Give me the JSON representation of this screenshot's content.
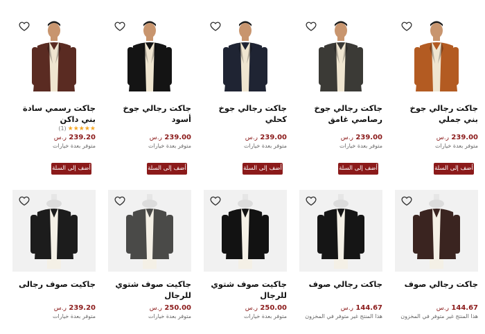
{
  "currency_symbol": "ر.س",
  "add_to_cart_label": "أضف إلى السلة",
  "row1": [
    {
      "title": "جاكت رجالي جوخ بني جملي",
      "price": "239.00",
      "stock": "متوفر بعدة خيارات",
      "jacket_color": "#b35b22",
      "rating": null
    },
    {
      "title": "جاكت رجالي جوخ رصاصي غامق",
      "price": "239.00",
      "stock": "متوفر بعدة خيارات",
      "jacket_color": "#3b3a36",
      "rating": null
    },
    {
      "title": "جاكت رجالي جوخ كحلي",
      "price": "239.00",
      "stock": "متوفر بعدة خيارات",
      "jacket_color": "#1f2433",
      "rating": null
    },
    {
      "title": "جاكت رجالي جوخ أسود",
      "price": "239.00",
      "stock": "متوفر بعدة خيارات",
      "jacket_color": "#141414",
      "rating": null
    },
    {
      "title": "جاكت رسمي سادة بني داكن",
      "price": "239.20",
      "stock": "متوفر بعدة خيارات",
      "jacket_color": "#5a2b22",
      "rating": {
        "stars": "★★★★★",
        "count": "(1)"
      }
    }
  ],
  "row2": [
    {
      "title": "جاكت رجالي صوف",
      "price": "144.67",
      "stock": "هذا المنتج غير متوفر في المخزون",
      "jacket_color": "#3a2420"
    },
    {
      "title": "جاكت رجالي صوف",
      "price": "144.67",
      "stock": "هذا المنتج غير متوفر في المخزون",
      "jacket_color": "#151515"
    },
    {
      "title": "جاكيت صوف شتوي للرجال",
      "price": "250.00",
      "stock": "متوفر بعدة خيارات",
      "jacket_color": "#121212"
    },
    {
      "title": "جاكيت صوف شتوي للرجال",
      "price": "250.00",
      "stock": "متوفر بعدة خيارات",
      "jacket_color": "#4a4a48"
    },
    {
      "title": "جاكيت صوف رجالى",
      "price": "239.20",
      "stock": "متوفر بعدة خيارات",
      "jacket_color": "#1c1c1c"
    }
  ],
  "colors": {
    "accent": "#8b1a1a",
    "star": "#f5a623",
    "image_bg_row2": "#f1f1f1"
  },
  "icons": {
    "wishlist": "heart-icon"
  }
}
